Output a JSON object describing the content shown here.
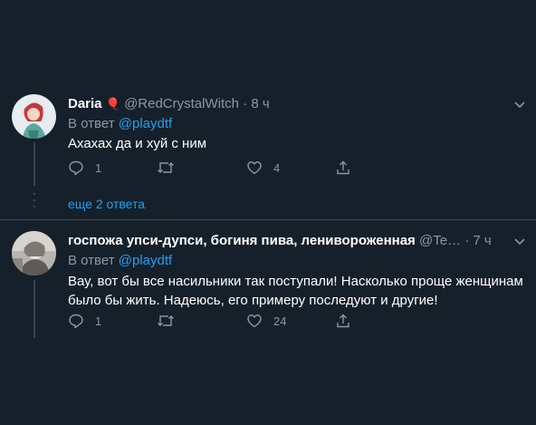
{
  "tweets": [
    {
      "name": "Daria",
      "emoji": "🎈",
      "handle": "@RedCrystalWitch",
      "sep": "·",
      "time": "8 ч",
      "reply_prefix": "В ответ",
      "reply_mention": "@playdtf",
      "text": "Ахахах да и хуй с ним",
      "reply_count": "1",
      "retweet_count": "",
      "like_count": "4"
    },
    {
      "name": "госпожа упси-дупси, богиня пива, ленивороженная",
      "handle": "@Te…",
      "sep": "·",
      "time": "7 ч",
      "reply_prefix": "В ответ",
      "reply_mention": "@playdtf",
      "text_line1": "Вау, вот бы все насильники так поступали! Насколько проще женщинам",
      "text_line2": "было бы жить. Надеюсь, его примеру последуют и другие!",
      "reply_count": "1",
      "retweet_count": "",
      "like_count": "24"
    }
  ],
  "more_replies": "еще 2 ответа",
  "colors": {
    "background": "#15202b",
    "secondary_text": "#8899a6",
    "accent": "#1da1f2",
    "divider": "#38444d"
  },
  "icons": [
    "reply-icon",
    "retweet-icon",
    "like-icon",
    "share-icon",
    "chevron-down-icon"
  ]
}
